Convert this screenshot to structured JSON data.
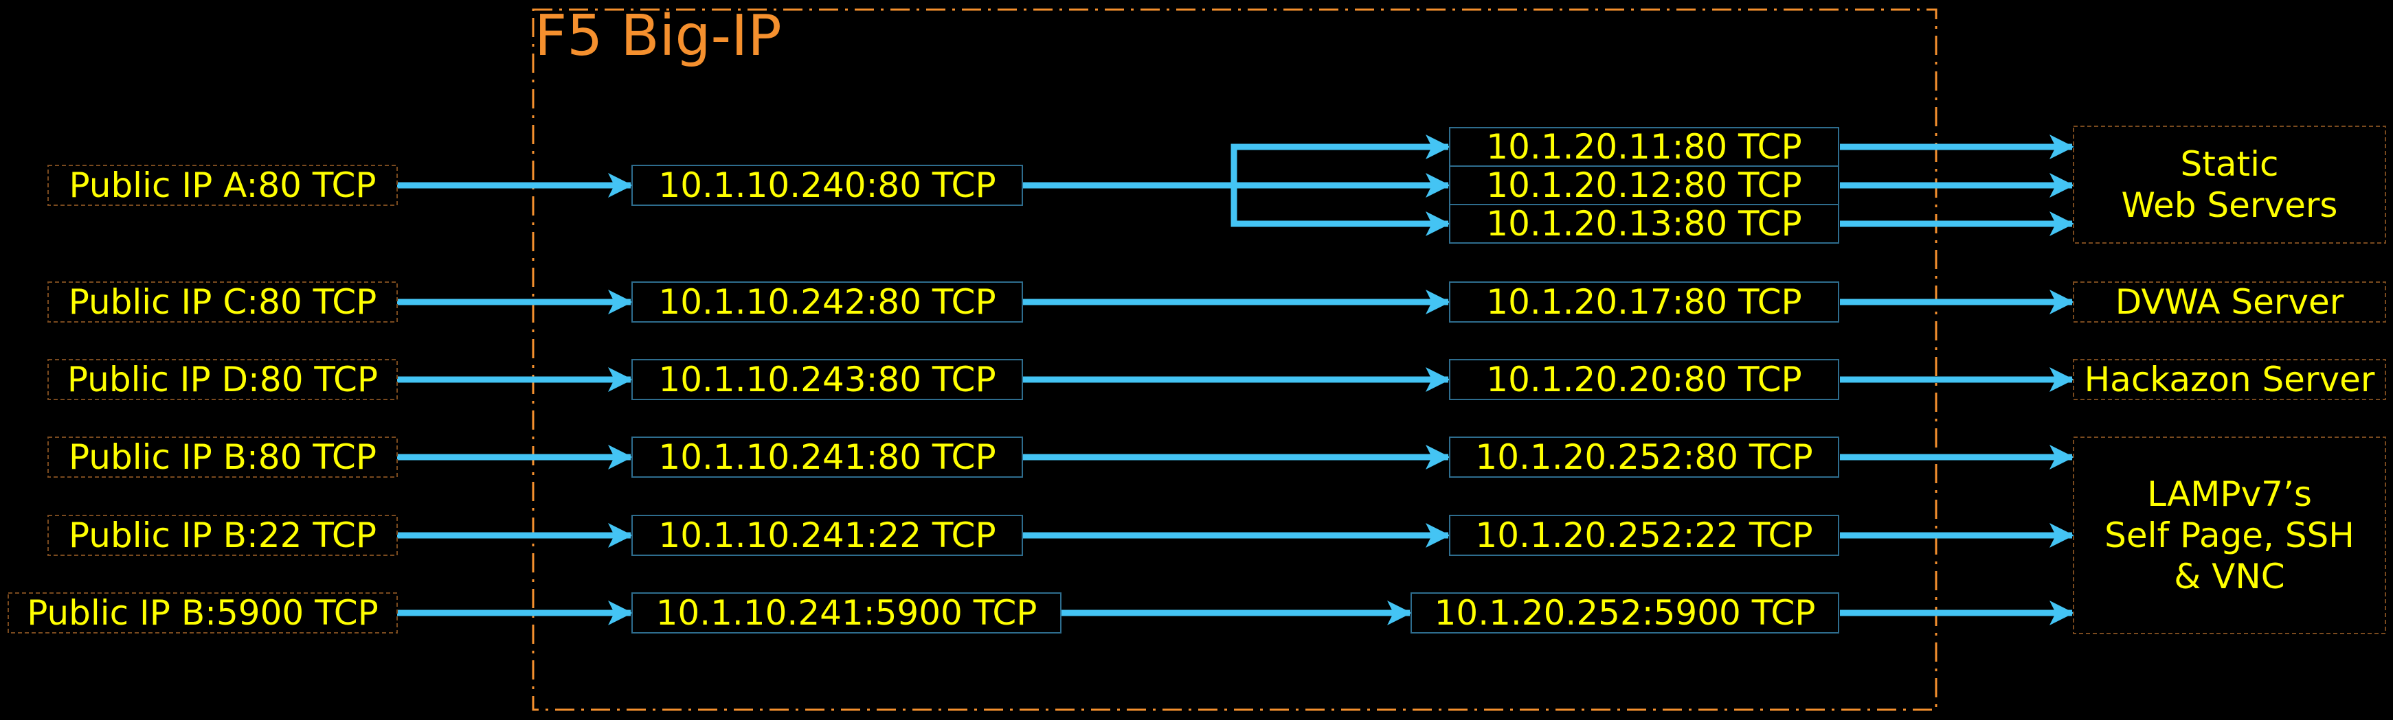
{
  "colors": {
    "background": "#000000",
    "text": "#ffff00",
    "title": "#f5902e",
    "arrow": "#44c4f4",
    "public_box_border": "#7a4a1e",
    "vip_box_border": "#2e6d8e",
    "dest_box_border": "#7a4a1e",
    "frame_border": "#f5902e"
  },
  "f5_frame": {
    "title": "F5 Big-IP"
  },
  "flows": [
    {
      "public": "Public IP A:80 TCP",
      "virtual": "10.1.10.240:80 TCP",
      "pool": [
        "10.1.20.11:80 TCP",
        "10.1.20.12:80 TCP",
        "10.1.20.13:80 TCP"
      ]
    },
    {
      "public": "Public IP C:80 TCP",
      "virtual": "10.1.10.242:80 TCP",
      "pool": [
        "10.1.20.17:80 TCP"
      ]
    },
    {
      "public": "Public IP D:80 TCP",
      "virtual": "10.1.10.243:80 TCP",
      "pool": [
        "10.1.20.20:80 TCP"
      ]
    },
    {
      "public": "Public IP B:80 TCP",
      "virtual": "10.1.10.241:80 TCP",
      "pool": [
        "10.1.20.252:80 TCP"
      ]
    },
    {
      "public": "Public IP B:22 TCP",
      "virtual": "10.1.10.241:22 TCP",
      "pool": [
        "10.1.20.252:22 TCP"
      ]
    },
    {
      "public": "Public IP B:5900 TCP",
      "virtual": "10.1.10.241:5900 TCP",
      "pool": [
        "10.1.20.252:5900 TCP"
      ]
    }
  ],
  "destinations": [
    {
      "lines": [
        "Static",
        "Web Servers"
      ]
    },
    {
      "lines": [
        "DVWA Server"
      ]
    },
    {
      "lines": [
        "Hackazon Server"
      ]
    },
    {
      "lines": [
        "LAMPv7’s",
        "Self Page, SSH",
        "& VNC"
      ]
    }
  ]
}
